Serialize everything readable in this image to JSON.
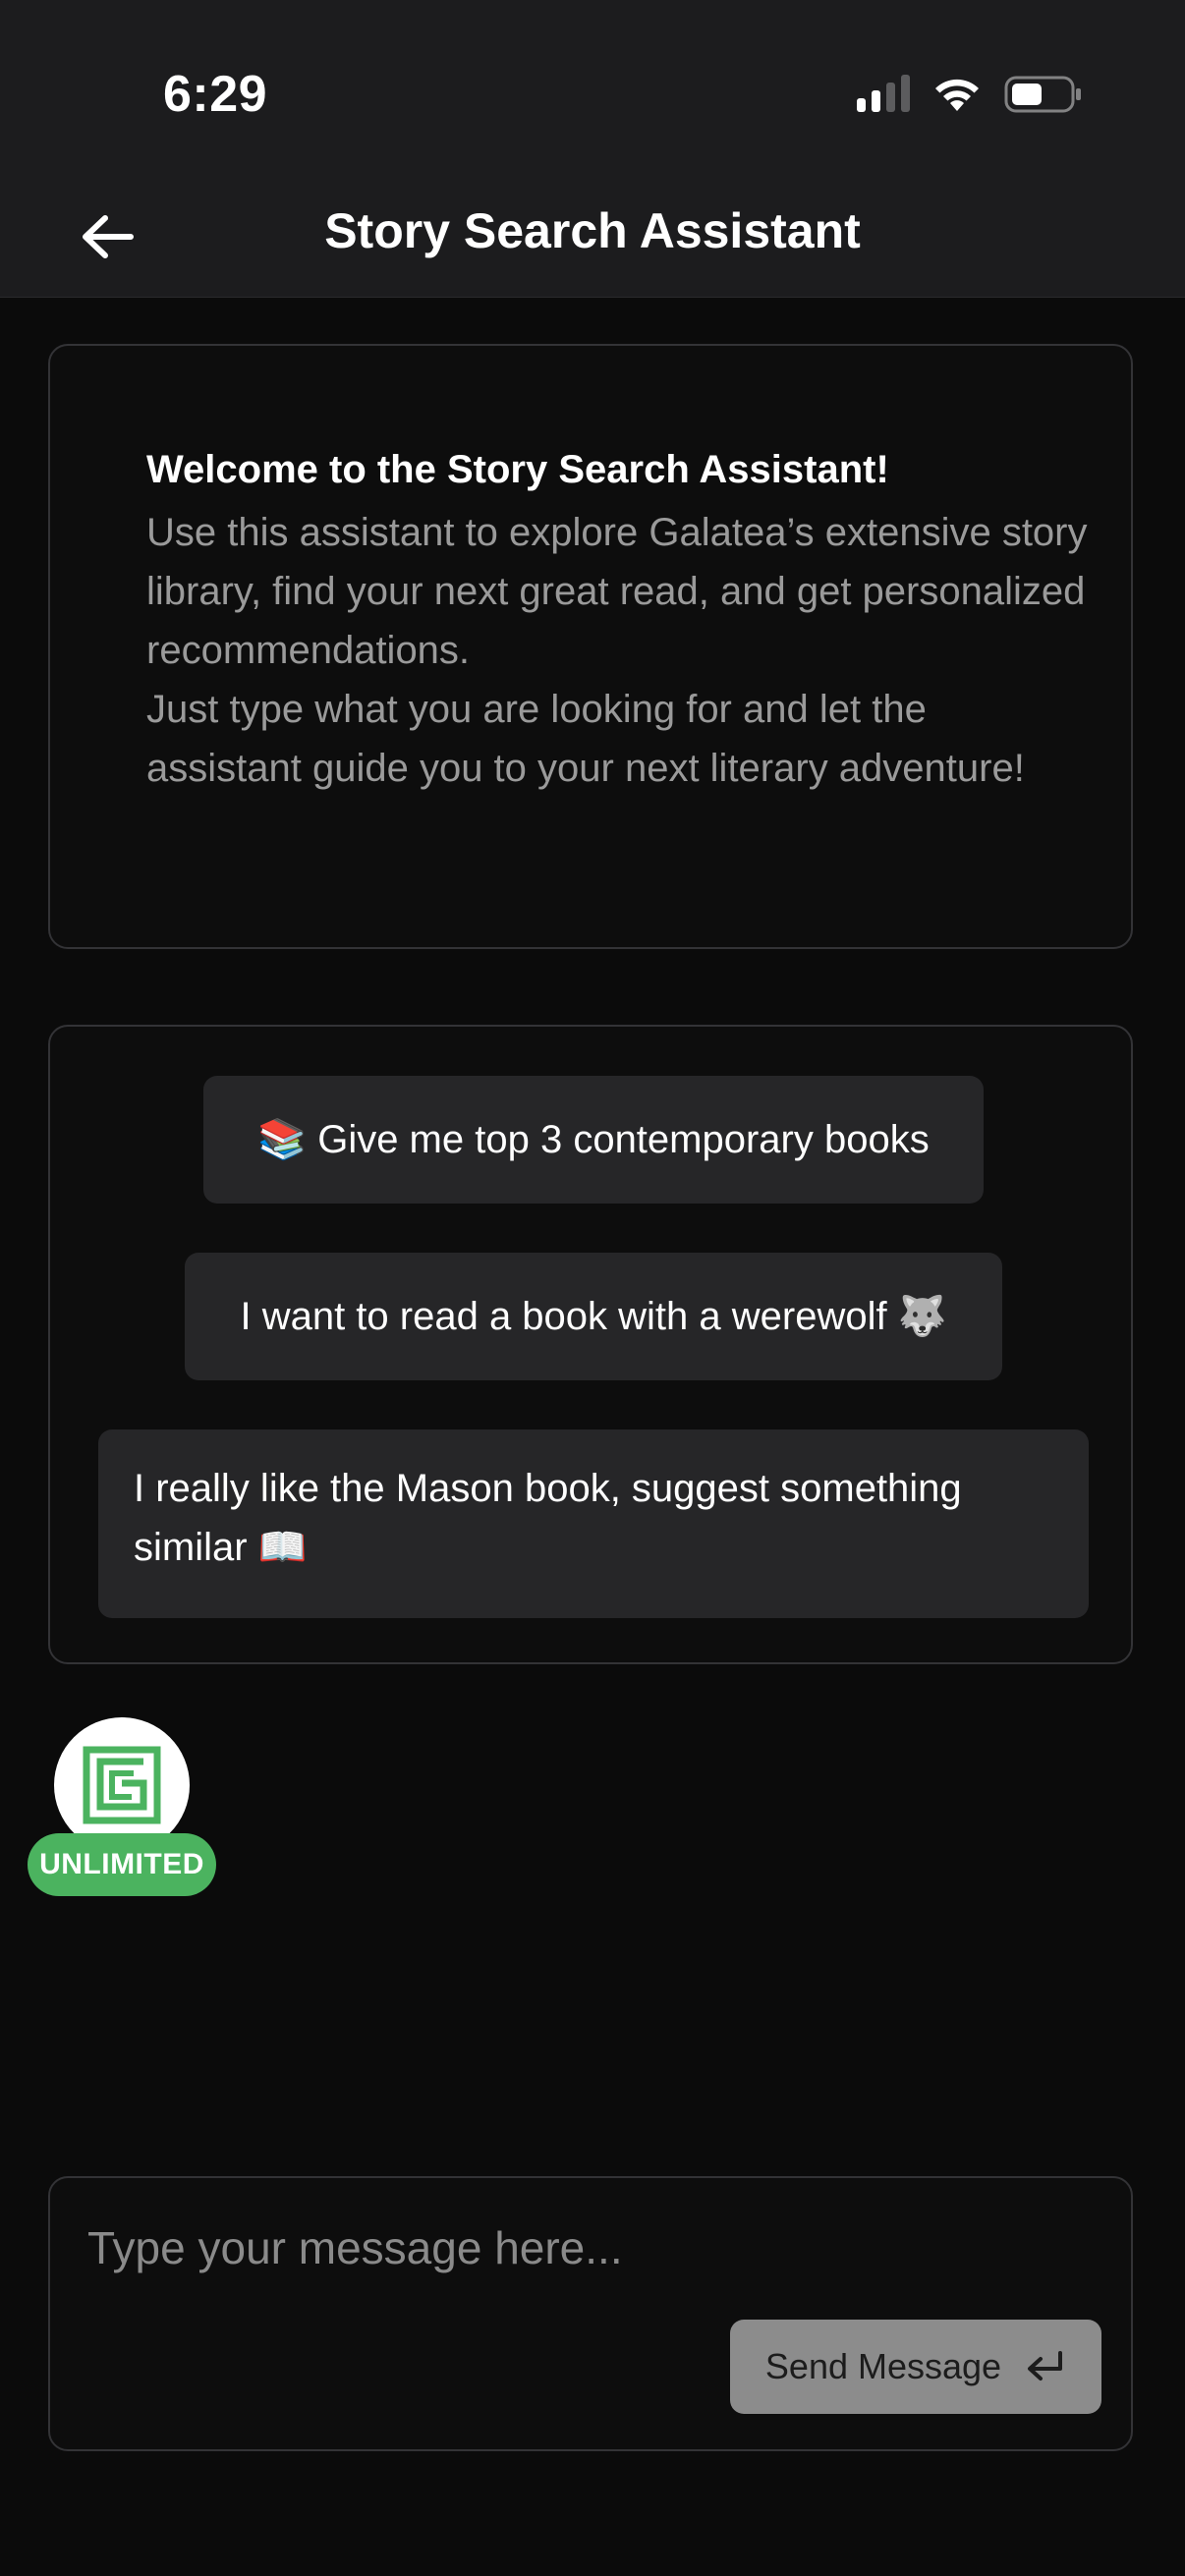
{
  "status_bar": {
    "time": "6:29",
    "icons": [
      "signal-icon",
      "wifi-icon",
      "battery-icon"
    ]
  },
  "header": {
    "title": "Story Search Assistant",
    "back_icon": "arrow-left-icon"
  },
  "welcome": {
    "heading": "Welcome to the Story Search Assistant!",
    "body": "Use this assistant to explore Galatea’s extensive story library, find your next great read, and get personalized recommendations.\nJust type what you are looking for and let the assistant guide you to your next literary adventure!"
  },
  "suggestions": [
    {
      "label": "📚 Give me top 3 contemporary books"
    },
    {
      "label": "I want to read a book with a werewolf 🐺"
    },
    {
      "label": "I really like the Mason book, suggest something similar 📖"
    }
  ],
  "assistant": {
    "avatar_icon": "galatea-logo-icon",
    "badge": "UNLIMITED"
  },
  "composer": {
    "placeholder": "Type your message here...",
    "send_label": "Send Message",
    "send_icon": "enter-return-icon"
  },
  "colors": {
    "background": "#0b0b0b",
    "header": "#1c1c1e",
    "chip": "#262628",
    "accent_green": "#4bb35f",
    "send_button": "#8c8c8c"
  }
}
